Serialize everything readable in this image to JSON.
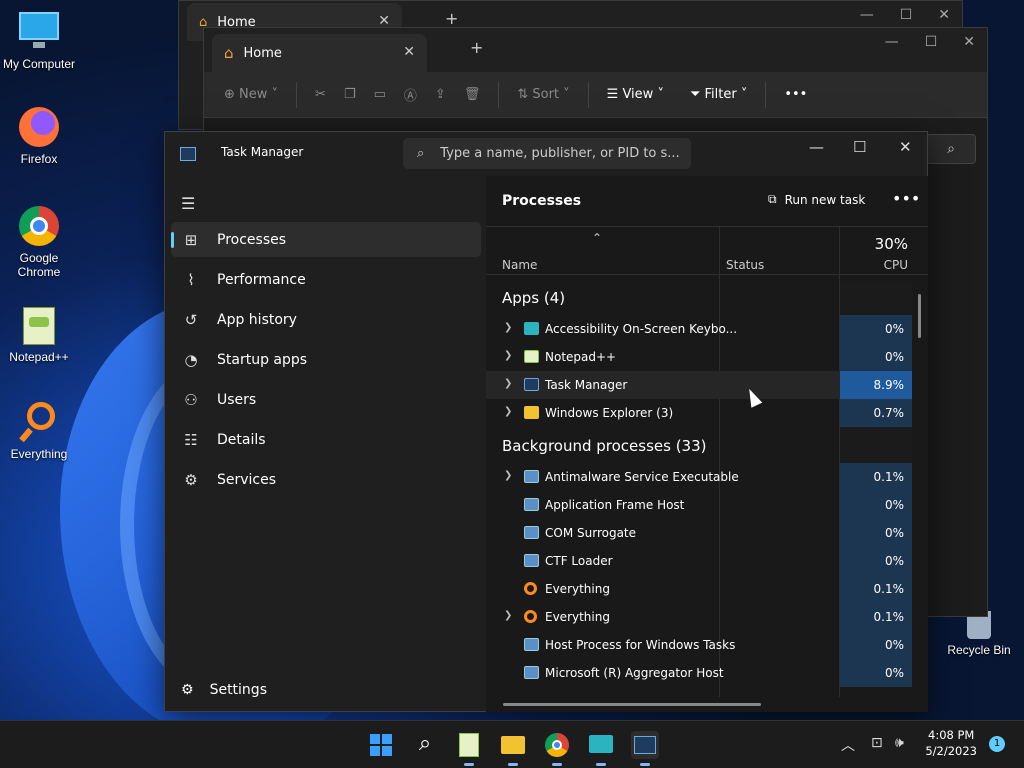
{
  "desktop": {
    "icons": [
      {
        "label": "My Computer"
      },
      {
        "label": "Firefox"
      },
      {
        "label": "Google Chrome"
      },
      {
        "label": "Notepad++"
      },
      {
        "label": "Everything"
      }
    ],
    "recycle_bin": "Recycle Bin"
  },
  "explorer_back": {
    "tab": "Home"
  },
  "explorer": {
    "tab": "Home",
    "toolbar": {
      "new": "New",
      "sort": "Sort",
      "view": "View",
      "filter": "Filter"
    }
  },
  "taskmanager": {
    "title": "Task Manager",
    "search_placeholder": "Type a name, publisher, or PID to s...",
    "nav": [
      {
        "label": "Processes",
        "icon": "processes-icon"
      },
      {
        "label": "Performance",
        "icon": "performance-icon"
      },
      {
        "label": "App history",
        "icon": "app-history-icon"
      },
      {
        "label": "Startup apps",
        "icon": "startup-icon"
      },
      {
        "label": "Users",
        "icon": "users-icon"
      },
      {
        "label": "Details",
        "icon": "details-icon"
      },
      {
        "label": "Services",
        "icon": "services-icon"
      }
    ],
    "settings": "Settings",
    "page_title": "Processes",
    "run_new_task": "Run new task",
    "columns": {
      "name": "Name",
      "status": "Status",
      "cpu_pct": "30%",
      "cpu": "CPU"
    },
    "groups": {
      "apps": {
        "label": "Apps (4)",
        "rows": [
          {
            "name": "Accessibility On-Screen Keybo...",
            "cpu": "0%"
          },
          {
            "name": "Notepad++",
            "cpu": "0%"
          },
          {
            "name": "Task Manager",
            "cpu": "8.9%"
          },
          {
            "name": "Windows Explorer (3)",
            "cpu": "0.7%"
          }
        ]
      },
      "background": {
        "label": "Background processes (33)",
        "rows": [
          {
            "name": "Antimalware Service Executable",
            "cpu": "0.1%"
          },
          {
            "name": "Application Frame Host",
            "cpu": "0%"
          },
          {
            "name": "COM Surrogate",
            "cpu": "0%"
          },
          {
            "name": "CTF Loader",
            "cpu": "0%"
          },
          {
            "name": "Everything",
            "cpu": "0.1%"
          },
          {
            "name": "Everything",
            "cpu": "0.1%"
          },
          {
            "name": "Host Process for Windows Tasks",
            "cpu": "0%"
          },
          {
            "name": "Microsoft (R) Aggregator Host",
            "cpu": "0%"
          }
        ]
      }
    }
  },
  "taskbar": {
    "time": "4:08 PM",
    "date": "5/2/2023",
    "notifications": "1"
  }
}
